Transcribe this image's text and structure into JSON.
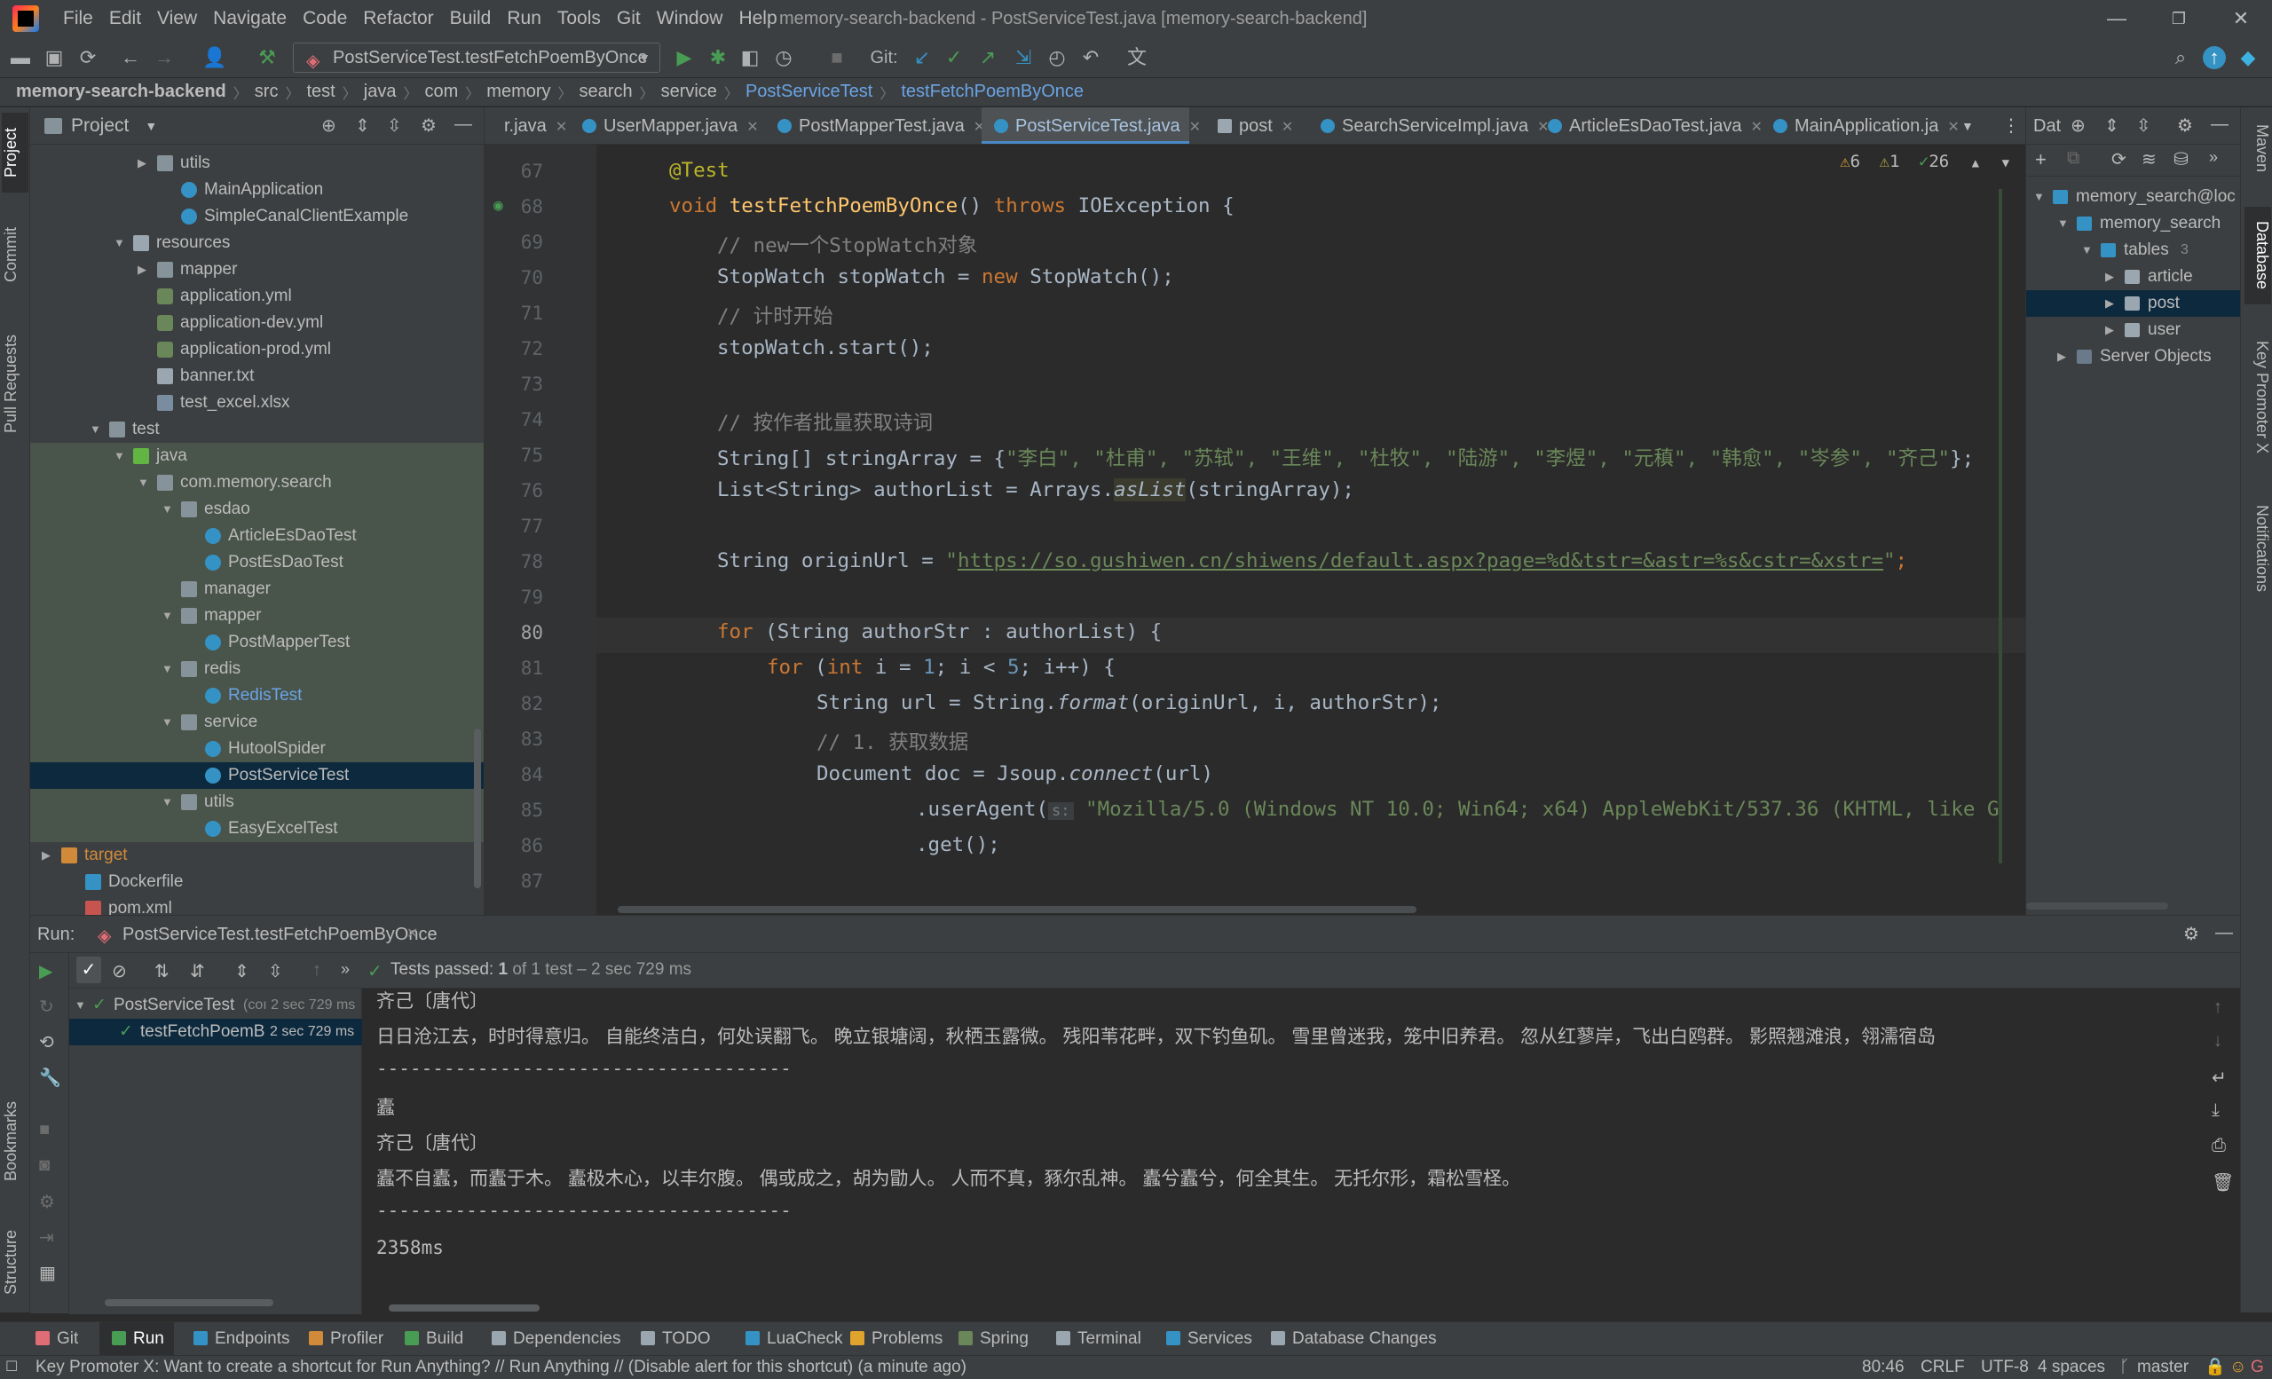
{
  "menu": {
    "items": [
      "File",
      "Edit",
      "View",
      "Navigate",
      "Code",
      "Refactor",
      "Build",
      "Run",
      "Tools",
      "Git",
      "Window",
      "Help"
    ]
  },
  "window": {
    "title": "memory-search-backend - PostServiceTest.java [memory-search-backend]",
    "minimize": "—",
    "restore": "❐",
    "close": "✕"
  },
  "toolbar": {
    "run_config": "PostServiceTest.testFetchPoemByOnce",
    "git_label": "Git:"
  },
  "breadcrumb": [
    "memory-search-backend",
    "src",
    "test",
    "java",
    "com",
    "memory",
    "search",
    "service",
    "PostServiceTest",
    "testFetchPoemByOnce"
  ],
  "stripe_left": {
    "project": "Project",
    "commit": "Commit",
    "pull_requests": "Pull Requests",
    "bookmarks": "Bookmarks",
    "structure": "Structure"
  },
  "stripe_right": {
    "maven": "Maven",
    "database": "Database",
    "key_promoter": "Key Promoter X",
    "notifications": "Notifications"
  },
  "project_panel": {
    "title": "Project",
    "tree": [
      {
        "label": "utils",
        "icon": "pkg"
      },
      {
        "label": "MainApplication",
        "icon": "cls"
      },
      {
        "label": "SimpleCanalClientExample",
        "icon": "cls"
      },
      {
        "label": "resources",
        "icon": "folder-res"
      },
      {
        "label": "mapper",
        "icon": "folder"
      },
      {
        "label": "application.yml",
        "icon": "yml"
      },
      {
        "label": "application-dev.yml",
        "icon": "yml"
      },
      {
        "label": "application-prod.yml",
        "icon": "yml"
      },
      {
        "label": "banner.txt",
        "icon": "txt"
      },
      {
        "label": "test_excel.xlsx",
        "icon": "xlsx"
      },
      {
        "label": "test",
        "icon": "folder"
      },
      {
        "label": "java",
        "icon": "folder-test"
      },
      {
        "label": "com.memory.search",
        "icon": "pkg"
      },
      {
        "label": "esdao",
        "icon": "pkg"
      },
      {
        "label": "ArticleEsDaoTest",
        "icon": "cls"
      },
      {
        "label": "PostEsDaoTest",
        "icon": "cls"
      },
      {
        "label": "manager",
        "icon": "pkg"
      },
      {
        "label": "mapper",
        "icon": "pkg"
      },
      {
        "label": "PostMapperTest",
        "icon": "cls"
      },
      {
        "label": "redis",
        "icon": "pkg"
      },
      {
        "label": "RedisTest",
        "icon": "cls"
      },
      {
        "label": "service",
        "icon": "pkg"
      },
      {
        "label": "HutoolSpider",
        "icon": "cls"
      },
      {
        "label": "PostServiceTest",
        "icon": "cls"
      },
      {
        "label": "utils",
        "icon": "pkg"
      },
      {
        "label": "EasyExcelTest",
        "icon": "cls"
      },
      {
        "label": "target",
        "icon": "folder-excl"
      },
      {
        "label": "Dockerfile",
        "icon": "docker"
      },
      {
        "label": "pom.xml",
        "icon": "maven"
      }
    ]
  },
  "tabs": [
    {
      "label": "r.java"
    },
    {
      "label": "UserMapper.java"
    },
    {
      "label": "PostMapperTest.java"
    },
    {
      "label": "PostServiceTest.java"
    },
    {
      "label": "post"
    },
    {
      "label": "SearchServiceImpl.java"
    },
    {
      "label": "ArticleEsDaoTest.java"
    },
    {
      "label": "MainApplication.ja"
    }
  ],
  "editor": {
    "inspection_warnings": "6",
    "inspection_weak": "1",
    "inspection_ok": "26",
    "lines": [
      "67",
      "68",
      "69",
      "70",
      "71",
      "72",
      "73",
      "74",
      "75",
      "76",
      "77",
      "78",
      "79",
      "80",
      "81",
      "82",
      "83",
      "84",
      "85",
      "86",
      "87"
    ],
    "code": {
      "l67": "@Test",
      "l68_void": "void ",
      "l68_name": "testFetchPoemByOnce",
      "l68_rest": "() ",
      "l68_throws": "throws",
      "l68_exc": " IOException {",
      "l69": "// new一个StopWatch对象",
      "l70_a": "StopWatch stopWatch = ",
      "l70_new": "new",
      "l70_b": " StopWatch();",
      "l71": "// 计时开始",
      "l72": "stopWatch.start();",
      "l74": "// 按作者批量获取诗词",
      "l75_a": "String[] stringArray = {",
      "l75_str": "\"李白\", \"杜甫\", \"苏轼\", \"王维\", \"杜牧\", \"陆游\", \"李煜\", \"元稹\", \"韩愈\", \"岑参\", \"齐己\"",
      "l75_b": "};",
      "l76_a": "List<String> authorList = Arrays.",
      "l76_m": "asList",
      "l76_b": "(stringArray);",
      "l78_a": "String originUrl = ",
      "l78_q1": "\"",
      "l78_url": "https://so.gushiwen.cn/shiwens/default.aspx?page=%d&tstr=&astr=%s&cstr=&xstr=",
      "l78_q2": "\"",
      "l78_b": ";",
      "l80_for": "for",
      "l80_b": " (String authorStr : authorList) {",
      "l81_for": "for",
      "l81_b": " (",
      "l81_int": "int",
      "l81_c": " i = ",
      "l81_n1": "1",
      "l81_d": "; i < ",
      "l81_n5": "5",
      "l81_e": "; i++) {",
      "l82_a": "String url = String.",
      "l82_m": "format",
      "l82_b": "(originUrl, i, authorStr);",
      "l83": "// 1. 获取数据",
      "l84_a": "Document doc = Jsoup.",
      "l84_m": "connect",
      "l84_b": "(url)",
      "l85_a": ".userAgent(",
      "l85_hint": "s:",
      "l85_str": " \"Mozilla/5.0 (Windows NT 10.0; Win64; x64) AppleWebKit/537.36 (KHTML, like G",
      "l86": ".get();"
    }
  },
  "db_panel": {
    "title": "Dat",
    "tree": [
      {
        "label": "memory_search@loc"
      },
      {
        "label": "memory_search"
      },
      {
        "label": "tables",
        "count": "3"
      },
      {
        "label": "article"
      },
      {
        "label": "post"
      },
      {
        "label": "user"
      },
      {
        "label": "Server Objects"
      }
    ]
  },
  "run_panel": {
    "label": "Run:",
    "tab": "PostServiceTest.testFetchPoemByOnce",
    "status_prefix": "Tests passed:",
    "status_count": "1",
    "status_suffix": "of 1 test – 2 sec 729 ms",
    "tree": [
      {
        "label": "PostServiceTest",
        "detail": "(coı 2 sec 729 ms"
      },
      {
        "label": "testFetchPoemB",
        "detail": "2 sec 729 ms"
      }
    ],
    "console": [
      "齐己〔唐代〕",
      "日日沧江去，时时得意归。 自能终洁白，何处误翻飞。 晚立银塘阔，秋栖玉露微。 残阳苇花畔，双下钓鱼矶。 雪里曾迷我，笼中旧养君。 忽从红蓼岸，飞出白鸥群。 影照翘滩浪，翎濡宿岛",
      "-------------------------------------",
      "蠹",
      "齐己〔唐代〕",
      "蠹不自蠹，而蠹于木。 蠹极木心，以丰尔腹。 偶或成之，胡为勖人。 人而不真，豩尔乱神。 蠹兮蠹兮，何全其生。 无托尔形，霜松雪柽。",
      "-------------------------------------",
      "2358ms"
    ]
  },
  "bottom_tools": [
    "Git",
    "Run",
    "Endpoints",
    "Profiler",
    "Build",
    "Dependencies",
    "TODO",
    "LuaCheck",
    "Problems",
    "Spring",
    "Terminal",
    "Services",
    "Database Changes"
  ],
  "statusbar": {
    "message": "Key Promoter X: Want to create a shortcut for Run Anything? // Run Anything // (Disable alert for this shortcut) (a minute ago)",
    "position": "80:46",
    "line_sep": "CRLF",
    "encoding": "UTF-8",
    "indent": "4 spaces",
    "branch": "master"
  },
  "colors": {
    "accent": "#4a88c7",
    "run_green": "#499c54",
    "keyword": "#cc7832",
    "string": "#6a8759"
  }
}
